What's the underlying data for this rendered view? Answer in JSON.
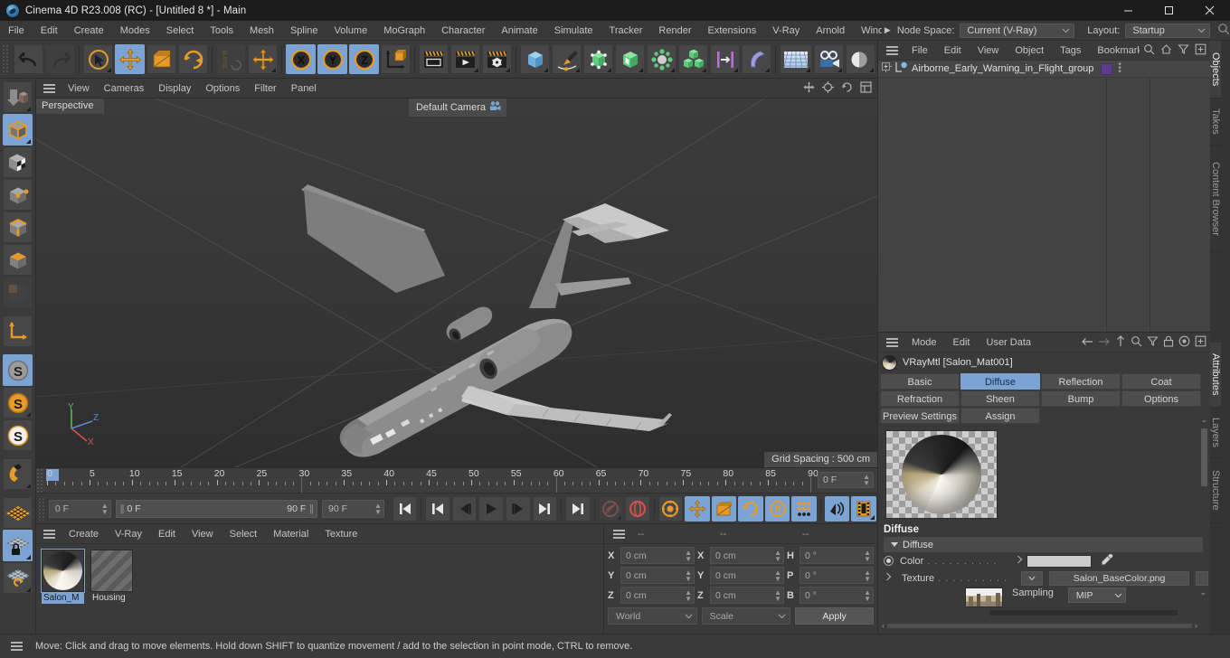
{
  "window": {
    "title": "Cinema 4D R23.008 (RC) - [Untitled 8 *] - Main",
    "minimize": "minimize-button",
    "maximize": "maximize-button",
    "close": "close-button"
  },
  "menubar": {
    "items": [
      "File",
      "Edit",
      "Create",
      "Modes",
      "Select",
      "Tools",
      "Mesh",
      "Spline",
      "Volume",
      "MoGraph",
      "Character",
      "Animate",
      "Simulate",
      "Tracker",
      "Render",
      "Extensions",
      "V-Ray",
      "Arnold",
      "Wind"
    ],
    "overflow_arrow": "▶",
    "node_space_label": "Node Space:",
    "node_space_value": "Current (V-Ray)",
    "layout_label": "Layout:",
    "layout_value": "Startup",
    "search_icon": "search-icon"
  },
  "toolbar": {
    "undo": "undo",
    "redo": "redo",
    "select": "live-selection",
    "move": "move-tool",
    "scale": "scale-tool",
    "rotate": "rotate-tool",
    "psr": "psr-lock",
    "move_dup": "move-tool-secondary",
    "x_axis": "X",
    "y_axis": "Y",
    "z_axis": "Z",
    "world_axis": "world-coordinate-system",
    "render_view": "render-view",
    "render_picture": "render-to-picture-viewer",
    "render_settings": "render-settings",
    "cube": "primitive-cube",
    "spline": "spline-pen",
    "nurbs": "generators",
    "deformer": "deformers",
    "scene": "scene-objects",
    "mograph": "mograph-cloner",
    "field": "field-objects",
    "bend": "deformer-bend",
    "floor": "environment",
    "camera": "camera-object",
    "light": "light-object"
  },
  "left_tools": [
    {
      "name": "make-editable",
      "state": "normal"
    },
    {
      "name": "model-mode",
      "state": "active"
    },
    {
      "name": "texture-mode",
      "state": "normal"
    },
    {
      "name": "points-mode",
      "state": "normal"
    },
    {
      "name": "edges-mode",
      "state": "normal"
    },
    {
      "name": "polygons-mode",
      "state": "normal"
    },
    {
      "name": "uv-mode",
      "state": "disabled"
    },
    {
      "name": "axis-modify",
      "state": "normal"
    },
    {
      "name": "enable-snapping",
      "state": "active"
    },
    {
      "name": "quantize-snap",
      "state": "normal"
    },
    {
      "name": "workplane-snap",
      "state": "normal"
    },
    {
      "name": "magnet-tool",
      "state": "normal"
    },
    {
      "name": "workplane",
      "state": "normal"
    },
    {
      "name": "lock-workplane",
      "state": "active"
    },
    {
      "name": "planar-workplane",
      "state": "normal"
    }
  ],
  "viewport": {
    "menu": [
      "View",
      "Cameras",
      "Display",
      "Options",
      "Filter",
      "Panel"
    ],
    "perspective_label": "Perspective",
    "camera_label": "Default Camera",
    "grid_spacing": "Grid Spacing : 500 cm",
    "axis": {
      "x": "X",
      "y": "Y",
      "z": "Z"
    },
    "model": "airborne-early-warning-aircraft"
  },
  "timeline": {
    "ticks": [
      0,
      5,
      10,
      15,
      20,
      25,
      30,
      35,
      40,
      45,
      50,
      55,
      60,
      65,
      70,
      75,
      80,
      85,
      90
    ],
    "current_frame_top": "0 F",
    "current_frame": "0 F",
    "range_start": "0 F",
    "range_end": "90 F",
    "end_frame": "90 F",
    "playhead_frame": 0,
    "controls": [
      {
        "name": "go-to-start"
      },
      {
        "name": "go-to-previous-key"
      },
      {
        "name": "step-back"
      },
      {
        "name": "play"
      },
      {
        "name": "step-forward"
      },
      {
        "name": "go-to-next-key"
      },
      {
        "name": "go-to-end"
      },
      {
        "name": "record-active-objects"
      },
      {
        "name": "autokeying"
      },
      {
        "name": "keyframe-selection"
      },
      {
        "name": "position-key"
      },
      {
        "name": "scale-key"
      },
      {
        "name": "rotation-key"
      },
      {
        "name": "parameter-key"
      },
      {
        "name": "point-level-animation"
      },
      {
        "name": "play-sound"
      },
      {
        "name": "timeline-filter"
      }
    ]
  },
  "material_manager": {
    "menu": [
      "Create",
      "V-Ray",
      "Edit",
      "View",
      "Select",
      "Material",
      "Texture"
    ],
    "materials": [
      {
        "name": "Salon_M",
        "selected": true
      },
      {
        "name": "Housing",
        "selected": false
      }
    ]
  },
  "coordinates": {
    "header": [
      "--",
      "--",
      "--"
    ],
    "position": [
      {
        "axis": "X",
        "value": "0 cm"
      },
      {
        "axis": "Y",
        "value": "0 cm"
      },
      {
        "axis": "Z",
        "value": "0 cm"
      }
    ],
    "size": [
      {
        "axis": "X",
        "value": "0 cm"
      },
      {
        "axis": "Y",
        "value": "0 cm"
      },
      {
        "axis": "Z",
        "value": "0 cm"
      }
    ],
    "rotation": [
      {
        "axis": "H",
        "value": "0 °"
      },
      {
        "axis": "P",
        "value": "0 °"
      },
      {
        "axis": "B",
        "value": "0 °"
      }
    ],
    "system": "World",
    "mode": "Scale",
    "apply": "Apply"
  },
  "object_manager": {
    "menu": [
      "File",
      "Edit",
      "View",
      "Object",
      "Tags",
      "Bookmarks"
    ],
    "icons": [
      "search-icon",
      "home-icon",
      "filter-icon",
      "add-icon"
    ],
    "objects": [
      {
        "name": "Airborne_Early_Warning_in_Flight_group",
        "tag_color": "#5d3c8e"
      }
    ]
  },
  "attributes": {
    "menu": [
      "Mode",
      "Edit",
      "User Data"
    ],
    "icons": [
      "back-arrow-icon",
      "forward-arrow-icon",
      "up-arrow-icon",
      "search-icon",
      "filter-icon",
      "lock-icon",
      "target-icon",
      "add-icon"
    ],
    "object_title": "VRayMtl [Salon_Mat001]",
    "tabs_row1": [
      "Basic",
      "Diffuse",
      "Reflection",
      "Coat"
    ],
    "tabs_row2": [
      "Refraction",
      "Sheen",
      "Bump",
      "Options"
    ],
    "tabs_row3": [
      "Preview Settings",
      "Assign"
    ],
    "active_tab": "Diffuse",
    "section_title": "Diffuse",
    "group_title": "Diffuse",
    "color_label": "Color",
    "texture_label": "Texture",
    "texture_value": "Salon_BaseColor.png",
    "sampling_label": "Sampling",
    "sampling_value": "MIP",
    "color_value": "#cbcbcb",
    "eyedropper": "eyedropper-icon"
  },
  "right_tabs": [
    {
      "label": "Objects",
      "active": true
    },
    {
      "label": "Takes",
      "active": false
    },
    {
      "label": "Content Browser",
      "active": false
    },
    {
      "label": "Attributes",
      "active": true
    },
    {
      "label": "Layers",
      "active": false
    },
    {
      "label": "Structure",
      "active": false
    }
  ],
  "statusbar": {
    "text": "Move: Click and drag to move elements. Hold down SHIFT to quantize movement / add to the selection in point mode, CTRL to remove."
  },
  "colors": {
    "accent": "#7ba4d4",
    "panel": "#3a3a3a",
    "orange": "#e59a2a",
    "tag_purple": "#5d3c8e"
  }
}
